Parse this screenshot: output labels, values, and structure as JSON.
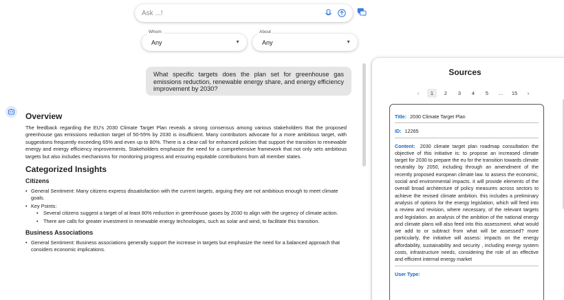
{
  "search": {
    "placeholder": "Ask ...!"
  },
  "filters": [
    {
      "label": "Whom",
      "value": "Any"
    },
    {
      "label": "About",
      "value": "Any"
    }
  ],
  "question": "What specific targets does the plan set for greenhouse gas emissions reduction, renewable energy share, and energy efficiency improvement by 2030?",
  "answer": {
    "overview_heading": "Overview",
    "overview_text": "The feedback regarding the EU's 2030 Climate Target Plan reveals a strong consensus among various stakeholders that the proposed greenhouse gas emissions reduction target of 50-55% by 2030 is insufficient. Many contributors advocate for a more ambitious target, with suggestions frequently exceeding 65% and even up to 80%. There is a clear call for enhanced policies that support the transition to renewable energy and energy efficiency improvements. Stakeholders emphasize the need for a comprehensive framework that not only sets ambitious targets but also includes mechanisms for monitoring progress and ensuring equitable contributions from all member states.",
    "categorized_heading": "Categorized Insights",
    "citizens_heading": "Citizens",
    "citizens_sentiment": "General Sentiment: Many citizens express dissatisfaction with the current targets, arguing they are not ambitious enough to meet climate goals.",
    "citizens_keypoints_label": "Key Points:",
    "citizens_keypoints": [
      "Several citizens suggest a target of at least 80% reduction in greenhouse gases by 2030 to align with the urgency of climate action.",
      "There are calls for greater investment in renewable energy technologies, such as solar and wind, to facilitate this transition."
    ],
    "business_heading": "Business Associations",
    "business_sentiment": "General Sentiment: Business associations generally support the increase in targets but emphasize the need for a balanced approach that considers economic implications."
  },
  "sources": {
    "title": "Sources",
    "pagination": {
      "prev": "‹",
      "pages": [
        "1",
        "2",
        "3",
        "4",
        "5"
      ],
      "ellipsis": "…",
      "last": "15",
      "next": "›",
      "active": "1"
    },
    "card": {
      "title_label": "Title:",
      "title_value": "2030 Climate Target Plan",
      "id_label": "ID:",
      "id_value": "12265",
      "content_label": "Content:",
      "content_value": "2030 climate target plan roadmap consultation the objective of this initiative is: to propose an increased climate target for 2030 to prepare the eu for the transition towards climate neutrality by 2050, including through an amendment of the recently proposed european climate law. to assess the economic, social and environmental impacts. it will provide elements of the overall broad architecture of policy measures across sectors to achieve the revised climate ambition. this includes a preliminary analysis of options for the energy legislation, which will feed into a review and revision, where necessary, of the relevant targets and legislation. an analysis of the ambition of the national energy and climate plans will also feed into this assessment. what would we add to or subtract from what will be assessed? more particularly, the initiative will assess: impacts on the energy affordability, sustainability and security , including energy system costs, infrastructure needs, considering the role of an effective and efficient internal energy market",
      "user_type_label": "User Type:"
    }
  }
}
